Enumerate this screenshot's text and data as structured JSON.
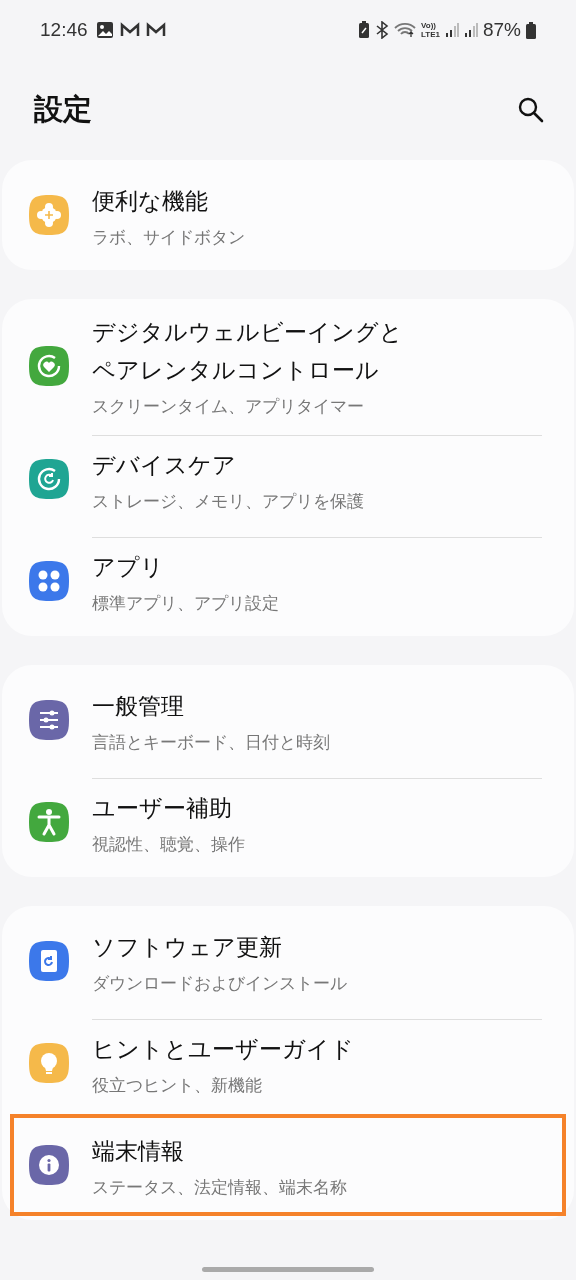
{
  "status_bar": {
    "time": "12:46",
    "volte": "Vo))",
    "network": "LTE1",
    "battery": "87%"
  },
  "header": {
    "title": "設定"
  },
  "groups": [
    {
      "items": [
        {
          "color": "#f5b94a",
          "title": "便利な機能",
          "subtitle": "ラボ、サイドボタン",
          "highlighted": false
        }
      ]
    },
    {
      "items": [
        {
          "color": "#43a83e",
          "title": "デジタルウェルビーイングとペアレンタルコントロール",
          "subtitle": "スクリーンタイム、アプリタイマー",
          "highlighted": false
        },
        {
          "color": "#1fa593",
          "title": "デバイスケア",
          "subtitle": "ストレージ、メモリ、アプリを保護",
          "highlighted": false
        },
        {
          "color": "#3c78ea",
          "title": "アプリ",
          "subtitle": "標準アプリ、アプリ設定",
          "highlighted": false
        }
      ]
    },
    {
      "items": [
        {
          "color": "#6a67a8",
          "title": "一般管理",
          "subtitle": "言語とキーボード、日付と時刻",
          "highlighted": false
        },
        {
          "color": "#43a83e",
          "title": "ユーザー補助",
          "subtitle": "視認性、聴覚、操作",
          "highlighted": false
        }
      ]
    },
    {
      "items": [
        {
          "color": "#3c78ea",
          "title": "ソフトウェア更新",
          "subtitle": "ダウンロードおよびインストール",
          "highlighted": false
        },
        {
          "color": "#f5b94a",
          "title": "ヒントとユーザーガイド",
          "subtitle": "役立つヒント、新機能",
          "highlighted": false
        },
        {
          "color": "#6a67a8",
          "title": "端末情報",
          "subtitle": "ステータス、法定情報、端末名称",
          "highlighted": true
        }
      ]
    }
  ]
}
